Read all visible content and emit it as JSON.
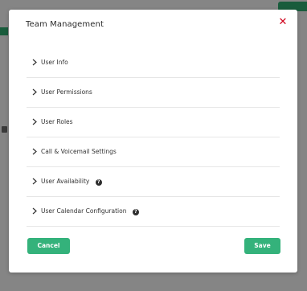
{
  "modal": {
    "title": "Team Management",
    "close_symbol": "✕",
    "sections": [
      {
        "label": "User Info",
        "has_help": false
      },
      {
        "label": "User Permissions",
        "has_help": false
      },
      {
        "label": "User Roles",
        "has_help": false
      },
      {
        "label": "Call & Voicemail Settings",
        "has_help": false
      },
      {
        "label": "User Availability",
        "has_help": true,
        "help_symbol": "?"
      },
      {
        "label": "User Calendar Configuration",
        "has_help": true,
        "help_symbol": "?"
      }
    ],
    "cancel_label": "Cancel",
    "save_label": "Save"
  },
  "colors": {
    "accent": "#34b27b",
    "close": "#d0021b",
    "overlay": "rgba(0,0,0,0.45)"
  },
  "icons": {
    "section_chevron": "chevron-right-icon",
    "help": "question-circle-icon",
    "close": "close-icon"
  }
}
